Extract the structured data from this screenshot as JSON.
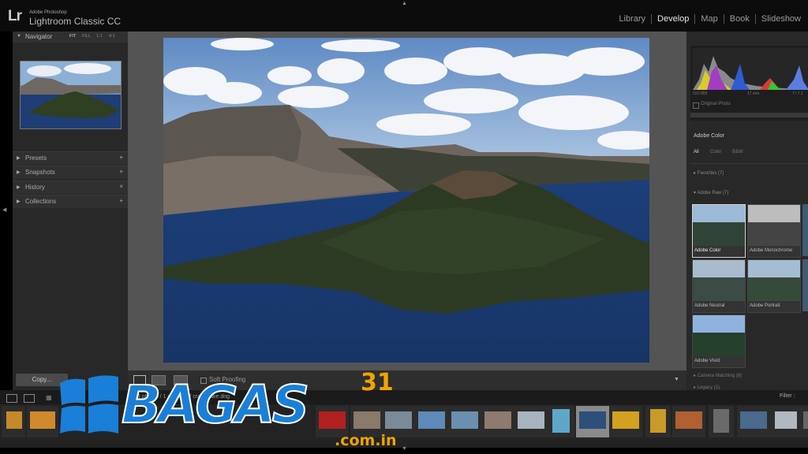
{
  "app": {
    "logo": "Lr",
    "vendor": "Adobe Photoshop",
    "name": "Lightroom Classic CC"
  },
  "modules": [
    "Library",
    "Develop",
    "Map",
    "Book",
    "Slideshow"
  ],
  "active_module": "Develop",
  "navigator": {
    "title": "Navigator",
    "zoom_options": [
      "FIT",
      "FILL",
      "1:1",
      "4:1"
    ]
  },
  "left_panels": [
    "Presets",
    "Snapshots",
    "History",
    "Collections"
  ],
  "left_buttons": {
    "copy": "Copy..."
  },
  "histogram": {
    "info_left": "ISO 800",
    "info_mid": "17 mm",
    "info_right": "f / 7.1",
    "original_photo": "Original Photo"
  },
  "profile": {
    "name": "Adobe Color",
    "filters": [
      "All",
      "Color",
      "B&W"
    ],
    "active_filter": "All",
    "favorites": "Favorites (7)",
    "group": "Adobe Raw (7)",
    "profiles": [
      "Adobe Color",
      "Adobe Monochrome",
      "Adobe Neutral",
      "Adobe Portrait",
      "Adobe Vivid"
    ],
    "camera_matching": "Camera Matching (8)",
    "legacy": "Legacy (1)"
  },
  "toolbar": {
    "soft_proofing": "Soft Proofing"
  },
  "filmbar": {
    "source": "64 photos / 1 selected / crater-lake.dng",
    "filter": "Filter :"
  },
  "watermark": {
    "text": "BAGAS",
    "superscript": "31",
    "domain": ".com.in"
  },
  "colors": {
    "accent_blue": "#1a7fd8",
    "panel_bg": "#282828",
    "center_bg": "#545454"
  },
  "icons": [
    "windows-logo-icon",
    "histogram-icon",
    "loupe-view-icon",
    "compare-view-icon"
  ]
}
